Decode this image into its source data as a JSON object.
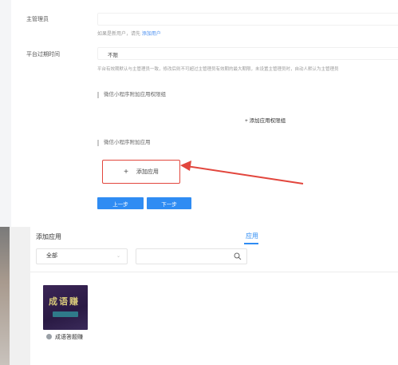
{
  "form": {
    "admin_label": "主管理员",
    "admin_hint_prefix": "如果是新用户，请先",
    "admin_hint_link": "添加用户",
    "expiry_label": "平台过期时间",
    "expiry_value": "不限",
    "expiry_hint": "平台有效期默认与主管理员一致，修改后则不可超过主管理员有效期的最大期限，未设置主管理员时，自动人默认为主管理员",
    "section_permission_title": "微信小程序附加应用权限组",
    "add_permission_label": "添加应用权限组",
    "section_apps_title": "微信小程序附加应用",
    "add_app_label": "添加应用",
    "prev_button": "上一步",
    "next_button": "下一步"
  },
  "dialog": {
    "title": "添加应用",
    "tab_label": "应用",
    "category_select": "全部",
    "search_placeholder": "",
    "apps": [
      {
        "name": "成语答题赚",
        "logo_text": "成语赚"
      }
    ]
  },
  "colors": {
    "accent": "#2f8cf3",
    "highlight_border": "#e2463d",
    "arrow": "#e2463d"
  }
}
